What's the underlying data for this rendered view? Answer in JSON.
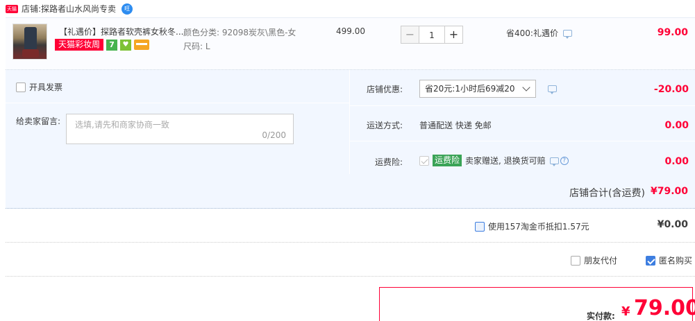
{
  "shop": {
    "badge": "天猫",
    "label": "店铺:",
    "name": "探路者山水风尚专卖",
    "wangwang": "旺"
  },
  "item": {
    "title": "【礼遇价】探路者软壳裤女秋冬...",
    "tags": {
      "tmall_festival": "天猫彩妆周",
      "seven_days": "7",
      "cup": "♥"
    },
    "sku_color": "颜色分类: 92098炭灰\\黑色-女",
    "sku_size": "尺码: L",
    "unit_price": "499.00",
    "quantity": "1",
    "qty_minus": "−",
    "qty_plus": "+",
    "promo": "省400:礼遇价",
    "total": "99.00"
  },
  "options": {
    "invoice_label": "开具发票",
    "message_label": "给卖家留言:",
    "message_placeholder": "选填,请先和商家协商一致",
    "message_count": "0/200",
    "coupon_label": "店铺优惠:",
    "coupon_value": "省20元:1小时后69减20",
    "coupon_amount": "-20.00",
    "shipping_label": "运送方式:",
    "shipping_value": "普通配送 快递 免邮",
    "shipping_amount": "0.00",
    "insurance_label": "运费险:",
    "insurance_tag": "运费险",
    "insurance_text": "卖家赠送, 退换货可赔",
    "insurance_amount": "0.00",
    "help": "?"
  },
  "shop_total": {
    "label": "店铺合计(含运费)",
    "value": "¥79.00"
  },
  "coins": {
    "label": "使用157淘金币抵扣1.57元",
    "value": "¥0.00"
  },
  "friend_pay": {
    "label": "朋友代付"
  },
  "anonymous": {
    "label": "匿名购买",
    "checked": true
  },
  "pay": {
    "label": "实付款:",
    "currency": "¥",
    "value": "79.00"
  },
  "colors": {
    "accent": "#ff0036",
    "panel": "#f2f7ff",
    "check": "#3d7ee0"
  }
}
